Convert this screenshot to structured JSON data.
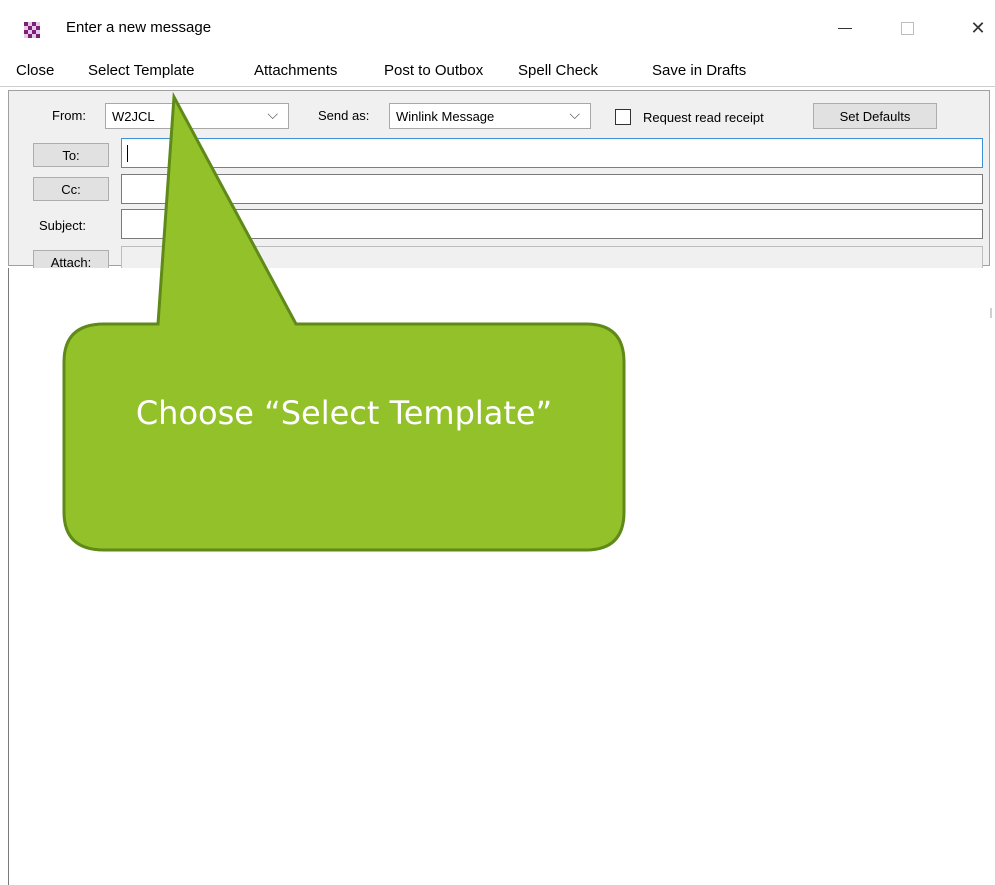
{
  "window": {
    "title": "Enter a new message",
    "icon": "checkered-app-icon",
    "controls": {
      "minimize_icon": "minimize-icon",
      "maximize_icon": "maximize-icon",
      "close_glyph": "✕"
    }
  },
  "menu": {
    "items": [
      {
        "label": "Close"
      },
      {
        "label": "Select Template"
      },
      {
        "label": "Attachments"
      },
      {
        "label": "Post to Outbox"
      },
      {
        "label": "Spell Check"
      },
      {
        "label": "Save in Drafts"
      }
    ]
  },
  "header": {
    "from_label": "From:",
    "from_value": "W2JCL",
    "send_as_label": "Send as:",
    "send_as_value": "Winlink Message",
    "chevron_glyph": "⌵",
    "read_receipt_label": "Request read receipt",
    "read_receipt_checked": false,
    "set_defaults_label": "Set Defaults",
    "to_button": "To:",
    "cc_button": "Cc:",
    "subject_label": "Subject:",
    "attach_button": "Attach:",
    "to_value": "",
    "cc_value": "",
    "subject_value": "",
    "attach_value": ""
  },
  "callout": {
    "text": "Choose “Select Template”",
    "color": "#93c12a",
    "border_color": "#5f8a1a"
  },
  "colors": {
    "focus_border": "#3d8fd6",
    "panel_bg": "#f0f0f0",
    "icon_purple": "#7a1f7a"
  }
}
